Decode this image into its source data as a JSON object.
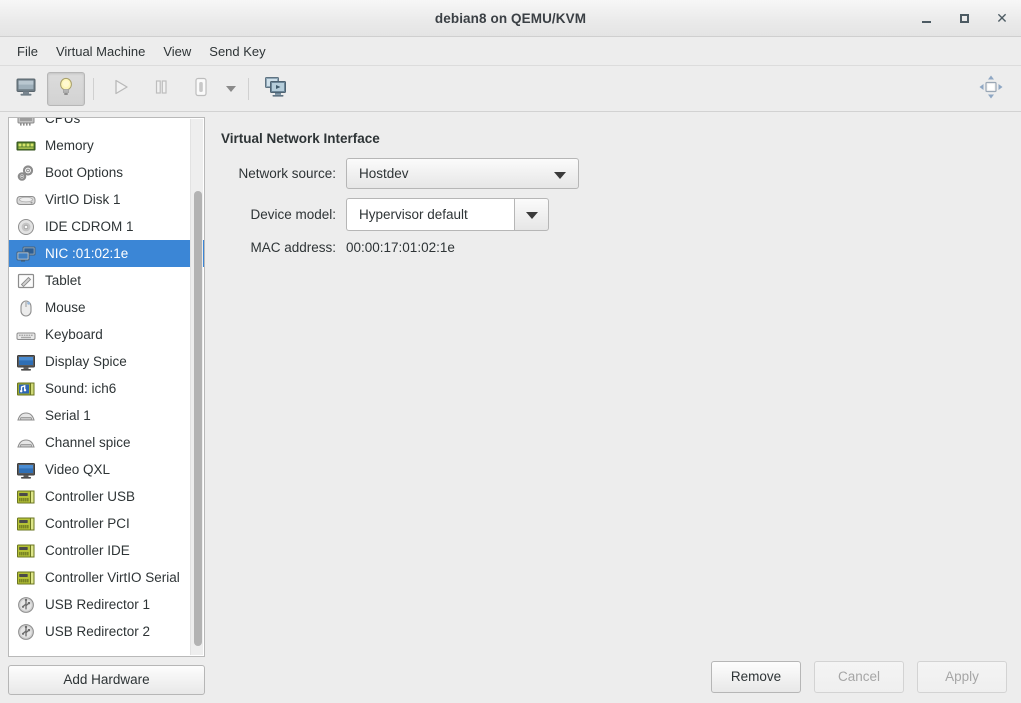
{
  "window": {
    "title": "debian8 on QEMU/KVM",
    "controls": {
      "minimize": "–",
      "maximize": "□",
      "close": "✕"
    }
  },
  "menubar": {
    "items": [
      {
        "label": "File"
      },
      {
        "label": "Virtual Machine"
      },
      {
        "label": "View"
      },
      {
        "label": "Send Key"
      }
    ]
  },
  "toolbar": {
    "buttons": [
      {
        "name": "console-view-icon",
        "tooltip": "Console view",
        "active": false
      },
      {
        "name": "details-view-icon",
        "tooltip": "Details view",
        "active": true
      },
      {
        "name": "run-icon",
        "tooltip": "Run",
        "active": false
      },
      {
        "name": "pause-icon",
        "tooltip": "Pause",
        "active": false
      },
      {
        "name": "shutdown-icon",
        "tooltip": "Shut down",
        "active": false
      },
      {
        "name": "shutdown-menu-arrow-icon",
        "tooltip": "Shut down options",
        "active": false
      },
      {
        "name": "snapshots-icon",
        "tooltip": "Manage snapshots",
        "active": false
      }
    ],
    "fullscreen_icon": "fullscreen-icon"
  },
  "sidebar": {
    "items": [
      {
        "label": "CPUs",
        "icon": "cpu-icon",
        "selected": false,
        "clipped": true
      },
      {
        "label": "Memory",
        "icon": "memory-icon",
        "selected": false
      },
      {
        "label": "Boot Options",
        "icon": "boot-options-icon",
        "selected": false
      },
      {
        "label": "VirtIO Disk 1",
        "icon": "disk-icon",
        "selected": false
      },
      {
        "label": "IDE CDROM 1",
        "icon": "cdrom-icon",
        "selected": false
      },
      {
        "label": "NIC :01:02:1e",
        "icon": "nic-icon",
        "selected": true
      },
      {
        "label": "Tablet",
        "icon": "tablet-icon",
        "selected": false
      },
      {
        "label": "Mouse",
        "icon": "mouse-icon",
        "selected": false
      },
      {
        "label": "Keyboard",
        "icon": "keyboard-icon",
        "selected": false
      },
      {
        "label": "Display Spice",
        "icon": "display-icon",
        "selected": false
      },
      {
        "label": "Sound: ich6",
        "icon": "sound-icon",
        "selected": false
      },
      {
        "label": "Serial 1",
        "icon": "serial-icon",
        "selected": false
      },
      {
        "label": "Channel spice",
        "icon": "channel-icon",
        "selected": false
      },
      {
        "label": "Video QXL",
        "icon": "video-icon",
        "selected": false
      },
      {
        "label": "Controller USB",
        "icon": "controller-icon",
        "selected": false
      },
      {
        "label": "Controller PCI",
        "icon": "controller-icon",
        "selected": false
      },
      {
        "label": "Controller IDE",
        "icon": "controller-icon",
        "selected": false
      },
      {
        "label": "Controller VirtIO Serial",
        "icon": "controller-icon",
        "selected": false
      },
      {
        "label": "USB Redirector 1",
        "icon": "usb-icon",
        "selected": false
      },
      {
        "label": "USB Redirector 2",
        "icon": "usb-icon",
        "selected": false
      }
    ],
    "add_hardware_label": "Add Hardware",
    "selection_color": "#3b86d6"
  },
  "main": {
    "section_title": "Virtual Network Interface",
    "fields": {
      "network_source": {
        "label": "Network source:",
        "value": "Hostdev",
        "type": "combobox"
      },
      "device_model": {
        "label": "Device model:",
        "value": "Hypervisor default",
        "type": "editable-combobox"
      },
      "mac_address": {
        "label": "MAC address:",
        "value": "00:00:17:01:02:1e",
        "type": "static"
      }
    }
  },
  "actions": {
    "remove": {
      "label": "Remove",
      "disabled": false
    },
    "cancel": {
      "label": "Cancel",
      "disabled": true
    },
    "apply": {
      "label": "Apply",
      "disabled": true
    }
  }
}
